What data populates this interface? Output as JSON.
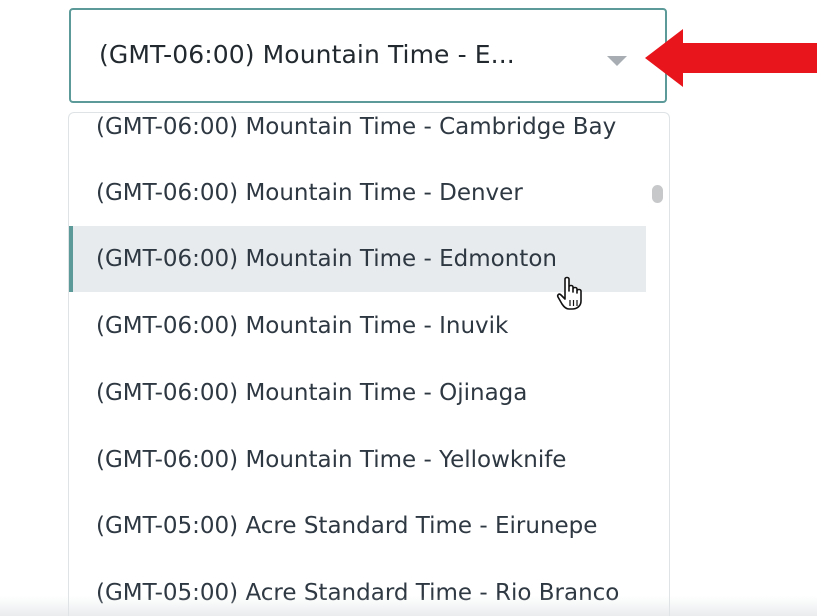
{
  "timezone_select": {
    "value": "(GMT-06:00) Mountain Time - E..."
  },
  "dropdown": {
    "options": [
      {
        "label": "(GMT-06:00) Mountain Time - Cambridge Bay"
      },
      {
        "label": "(GMT-06:00) Mountain Time - Denver"
      },
      {
        "label": "(GMT-06:00) Mountain Time - Edmonton"
      },
      {
        "label": "(GMT-06:00) Mountain Time - Inuvik"
      },
      {
        "label": "(GMT-06:00) Mountain Time - Ojinaga"
      },
      {
        "label": "(GMT-06:00) Mountain Time - Yellowknife"
      },
      {
        "label": "(GMT-05:00) Acre Standard Time - Eirunepe"
      },
      {
        "label": "(GMT-05:00) Acre Standard Time - Rio Branco"
      }
    ],
    "highlighted_index": 2
  },
  "annotation": {
    "arrow_color": "#e8161c"
  },
  "icons": {
    "chevron": "chevron-down-icon",
    "arrow": "red-arrow-icon",
    "cursor": "hand-pointer-cursor-icon"
  },
  "colors": {
    "accent": "#5c9a99",
    "highlight_bg": "#e8ebee",
    "text": "#2e3842"
  }
}
